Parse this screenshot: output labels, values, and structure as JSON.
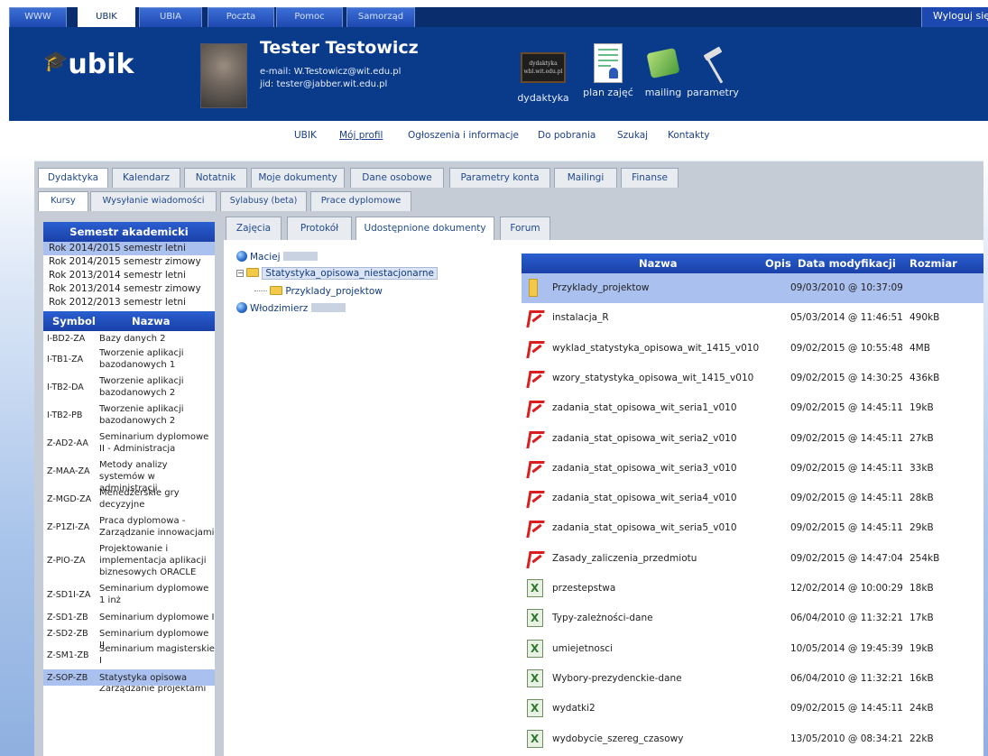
{
  "topnav": {
    "tabs": [
      "WWW",
      "UBIK",
      "UBIA",
      "Poczta",
      "Pomoc",
      "Samorząd"
    ],
    "active": "UBIK",
    "logout_label": "Wyloguj się"
  },
  "header": {
    "logo_text": "ubik",
    "user_name": "Tester Testowicz",
    "email": "e-mail: W.Testowicz@wit.edu.pl",
    "jid": "jid: tester@jabber.wit.edu.pl",
    "tools": [
      "dydaktyka",
      "plan zajęć",
      "mailing",
      "parametry"
    ]
  },
  "subnav": [
    "UBIK",
    "Mój profil",
    "Ogłoszenia i informacje",
    "Do pobrania",
    "Szukaj",
    "Kontakty"
  ],
  "main_tabs": [
    "Dydaktyka",
    "Kalendarz",
    "Notatnik",
    "Moje dokumenty",
    "Dane osobowe",
    "Parametry konta",
    "Mailingi",
    "Finanse"
  ],
  "sub_tabs": [
    "Kursy",
    "Wysyłanie wiadomości",
    "Sylabusy (beta)",
    "Prace dyplomowe"
  ],
  "content_tabs": [
    "Zajęcia",
    "Protokół",
    "Udostępnione dokumenty",
    "Forum"
  ],
  "semester": {
    "title": "Semestr akademicki",
    "items": [
      "Rok 2014/2015 semestr letni",
      "Rok 2014/2015 semestr zimowy",
      "Rok 2013/2014 semestr letni",
      "Rok 2013/2014 semestr zimowy",
      "Rok 2012/2013 semestr letni"
    ],
    "selected_index": 0
  },
  "courses": {
    "col_symbol": "Symbol",
    "col_name": "Nazwa",
    "items": [
      {
        "symbol": "I-BD2-ZA",
        "name": "Bazy danych 2"
      },
      {
        "symbol": "I-TB1-ZA",
        "name": "Tworzenie aplikacji bazodanowych 1"
      },
      {
        "symbol": "I-TB2-DA",
        "name": "Tworzenie aplikacji bazodanowych 2"
      },
      {
        "symbol": "I-TB2-PB",
        "name": "Tworzenie aplikacji bazodanowych 2"
      },
      {
        "symbol": "Z-AD2-AA",
        "name": "Seminarium dyplomowe II - Administracja"
      },
      {
        "symbol": "Z-MAA-ZA",
        "name": "Metody analizy systemów w administracji"
      },
      {
        "symbol": "Z-MGD-ZA",
        "name": "Menedżerskie gry decyzyjne"
      },
      {
        "symbol": "Z-P1ZI-ZA",
        "name": "Praca dyplomowa - Zarządzanie innowacjami"
      },
      {
        "symbol": "Z-PIO-ZA",
        "name": "Projektowanie i implementacja aplikacji biznesowych ORACLE"
      },
      {
        "symbol": "Z-SD1I-ZA",
        "name": "Seminarium dyplomowe 1 inż"
      },
      {
        "symbol": "Z-SD1-ZB",
        "name": "Seminarium dyplomowe I"
      },
      {
        "symbol": "Z-SD2-ZB",
        "name": "Seminarium dyplomowe II"
      },
      {
        "symbol": "Z-SM1-ZB",
        "name": "Seminarium magisterskie I"
      },
      {
        "symbol": "Z-SOP-ZB",
        "name": "Statystyka opisowa"
      },
      {
        "symbol": "",
        "name": "Zarządzanie projektami"
      }
    ],
    "selected_index": 13
  },
  "tree": {
    "nodes": [
      {
        "label": "Maciej"
      },
      {
        "label": "Statystyka_opisowa_niestacjonarne"
      },
      {
        "label": "Przyklady_projektow"
      },
      {
        "label": "Włodzimierz"
      }
    ]
  },
  "files": {
    "headers": {
      "name": "Nazwa",
      "desc": "Opis",
      "date": "Data modyfikacji",
      "size": "Rozmiar"
    },
    "rows": [
      {
        "icon": "folder-icon",
        "name": "Przyklady_projektow",
        "date": "09/03/2010 @ 10:37:09",
        "size": ""
      },
      {
        "icon": "pdf-icon",
        "name": "instalacja_R",
        "date": "05/03/2014 @ 11:46:51",
        "size": "490kB"
      },
      {
        "icon": "pdf-icon",
        "name": "wyklad_statystyka_opisowa_wit_1415_v010",
        "date": "09/02/2015 @ 10:55:48",
        "size": "4MB"
      },
      {
        "icon": "pdf-icon",
        "name": "wzory_statystyka_opisowa_wit_1415_v010",
        "date": "09/02/2015 @ 14:30:25",
        "size": "436kB"
      },
      {
        "icon": "pdf-icon",
        "name": "zadania_stat_opisowa_wit_seria1_v010",
        "date": "09/02/2015 @ 14:45:11",
        "size": "19kB"
      },
      {
        "icon": "pdf-icon",
        "name": "zadania_stat_opisowa_wit_seria2_v010",
        "date": "09/02/2015 @ 14:45:11",
        "size": "27kB"
      },
      {
        "icon": "pdf-icon",
        "name": "zadania_stat_opisowa_wit_seria3_v010",
        "date": "09/02/2015 @ 14:45:11",
        "size": "33kB"
      },
      {
        "icon": "pdf-icon",
        "name": "zadania_stat_opisowa_wit_seria4_v010",
        "date": "09/02/2015 @ 14:45:11",
        "size": "28kB"
      },
      {
        "icon": "pdf-icon",
        "name": "zadania_stat_opisowa_wit_seria5_v010",
        "date": "09/02/2015 @ 14:45:11",
        "size": "29kB"
      },
      {
        "icon": "pdf-icon",
        "name": "Zasady_zaliczenia_przedmiotu",
        "date": "09/02/2015 @ 14:47:04",
        "size": "254kB"
      },
      {
        "icon": "xls-icon",
        "name": "przestepstwa",
        "date": "12/02/2014 @ 10:00:29",
        "size": "18kB"
      },
      {
        "icon": "xls-icon",
        "name": "Typy-zależności-dane",
        "date": "06/04/2010 @ 11:32:21",
        "size": "17kB"
      },
      {
        "icon": "xls-icon",
        "name": "umiejetnosci",
        "date": "10/05/2014 @ 19:45:39",
        "size": "19kB"
      },
      {
        "icon": "xls-icon",
        "name": "Wybory-prezydenckie-dane",
        "date": "06/04/2010 @ 11:32:21",
        "size": "16kB"
      },
      {
        "icon": "xls-icon",
        "name": "wydatki2",
        "date": "09/02/2015 @ 14:45:11",
        "size": "24kB"
      },
      {
        "icon": "xls-icon",
        "name": "wydobycie_szereg_czasowy",
        "date": "13/05/2010 @ 08:34:21",
        "size": "22kB"
      }
    ],
    "selected_index": 0
  }
}
